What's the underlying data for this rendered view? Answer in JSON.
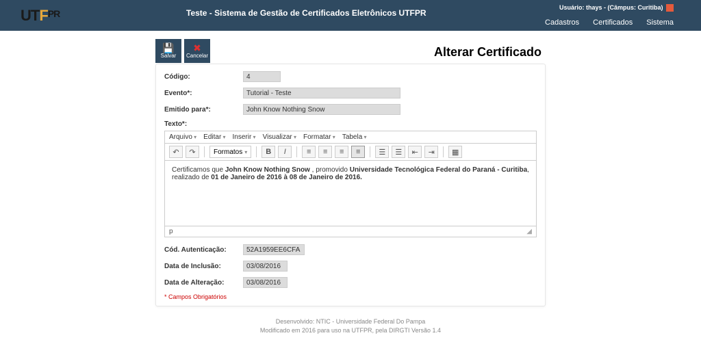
{
  "header": {
    "logo_ut": "UT",
    "logo_f": "F",
    "logo_pr": "PR",
    "app_title": "Teste - Sistema de Gestão de Certificados Eletrônicos UTFPR",
    "user_label": "Usuário: thays - (Câmpus: Curitiba)",
    "nav": {
      "cadastros": "Cadastros",
      "certificados": "Certificados",
      "sistema": "Sistema"
    }
  },
  "toolbar": {
    "save": "Salvar",
    "cancel": "Cancelar"
  },
  "page_title": "Alterar Certificado",
  "form": {
    "codigo_label": "Código:",
    "codigo_value": "4",
    "evento_label": "Evento*:",
    "evento_value": "Tutorial - Teste",
    "emitido_label": "Emitido para*:",
    "emitido_value": "John Know Nothing Snow",
    "texto_label": "Texto*:",
    "auth_label": "Cód. Autenticação:",
    "auth_value": "52A1959EE6CFA",
    "inclusao_label": "Data de Inclusão:",
    "inclusao_value": "03/08/2016",
    "alteracao_label": "Data de Alteração:",
    "alteracao_value": "03/08/2016",
    "required_note": "* Campos Obrigatórios"
  },
  "editor": {
    "menu": {
      "arquivo": "Arquivo",
      "editar": "Editar",
      "inserir": "Inserir",
      "visualizar": "Visualizar",
      "formatar": "Formatar",
      "tabela": "Tabela"
    },
    "formats": "Formatos",
    "body_prefix": "Certificamos que ",
    "body_name": "John Know Nothing Snow",
    "body_mid": " , promovido ",
    "body_inst": "Universidade Tecnológica Federal do Paraná - Curitiba",
    "body_suffix": ", realizado de ",
    "body_dates": "01 de Janeiro de 2016 à 08 de Janeiro de 2016.",
    "status_path": "p"
  },
  "footer": {
    "line1": "Desenvolvido: NTIC - Universidade Federal Do Pampa",
    "line2": "Modificado em 2016 para uso na UTFPR, pela DIRGTI Versão 1.4"
  }
}
